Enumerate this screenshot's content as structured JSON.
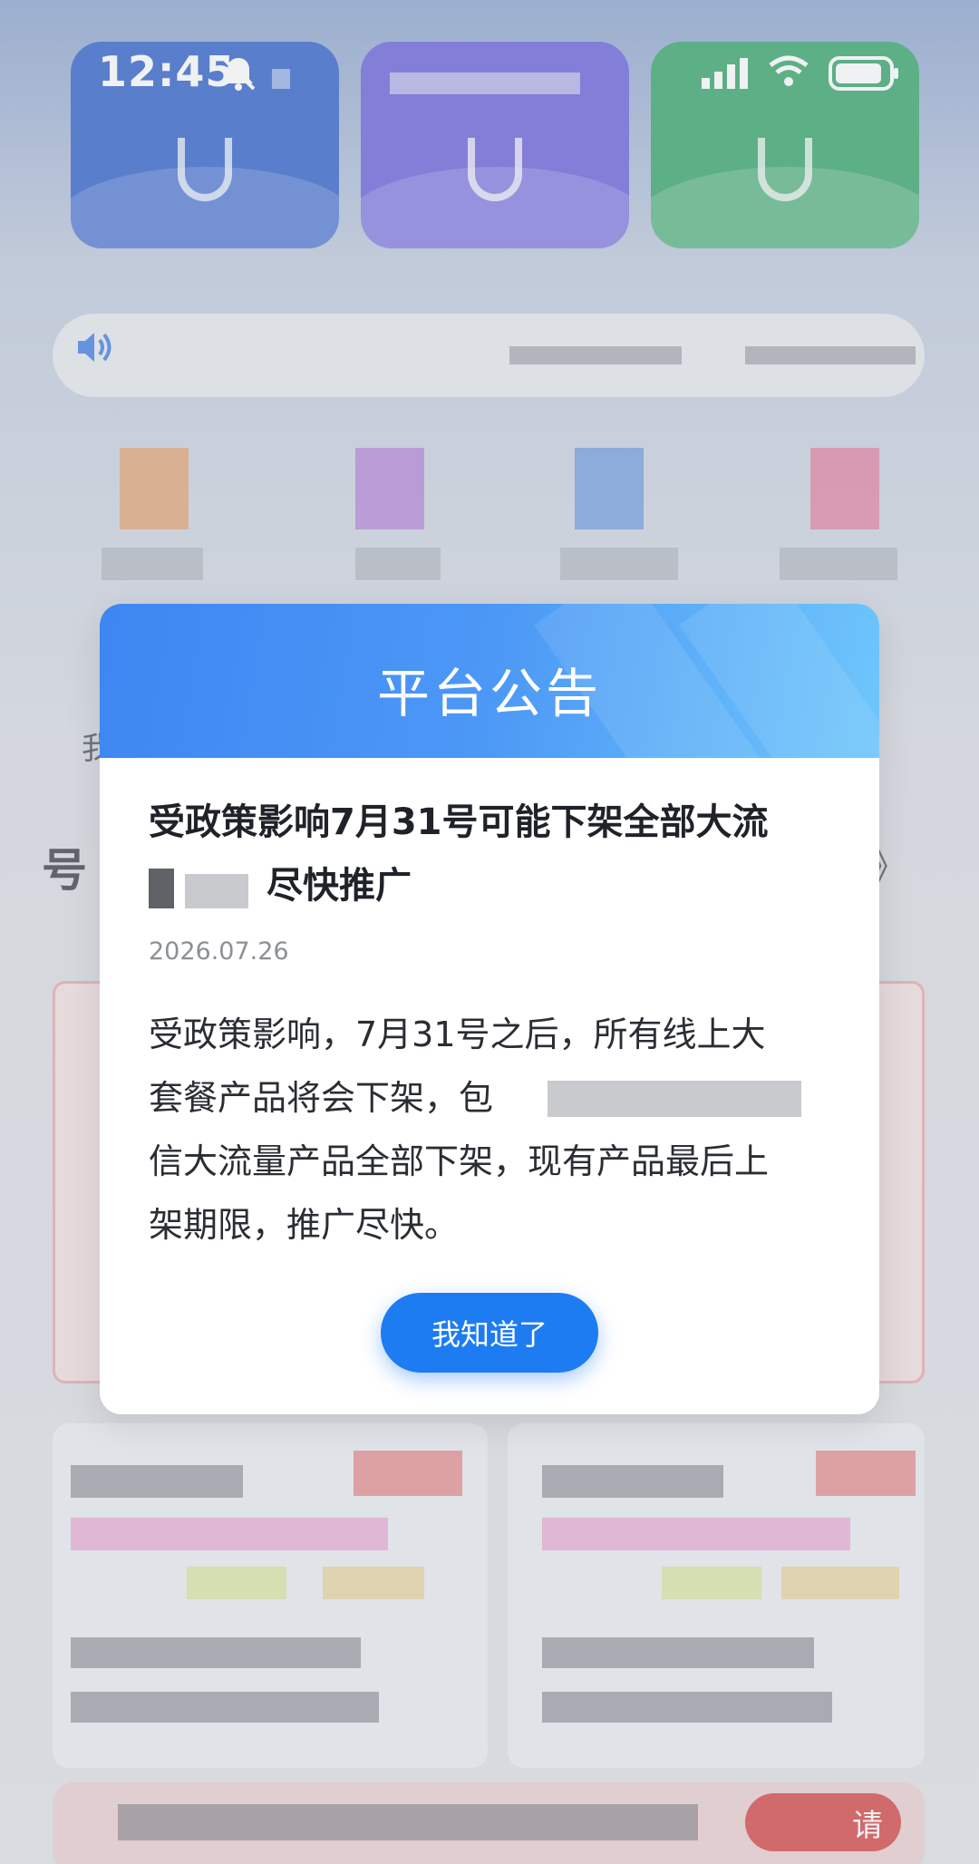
{
  "status_bar": {
    "time": "12:45",
    "icons": [
      "bell-muted-icon",
      "signal-icon",
      "wifi-icon",
      "battery-icon"
    ]
  },
  "background": {
    "top_cards": [
      {
        "color": "#1a4fc4"
      },
      {
        "color": "#5a4fd6"
      },
      {
        "color": "#1f9a58"
      }
    ],
    "notice_icon": "speaker-icon",
    "section_arrows": "》",
    "partial_char": "我",
    "bottom_button_text": "请"
  },
  "modal": {
    "title": "平台公告",
    "heading_line1": "受政策影响7月31号可能下架全部大流",
    "heading_line2": "尽快推广",
    "date": "2026.07.26",
    "body_line1": "受政策影响，7月31号之后，所有线上大",
    "body_line2": "套餐产品将会下架，包",
    "body_line3": "信大流量产品全部下架，现有产品最后上",
    "body_line4": "架期限，推广尽快。",
    "confirm_label": "我知道了",
    "accent_color": "#1d7cf2"
  }
}
